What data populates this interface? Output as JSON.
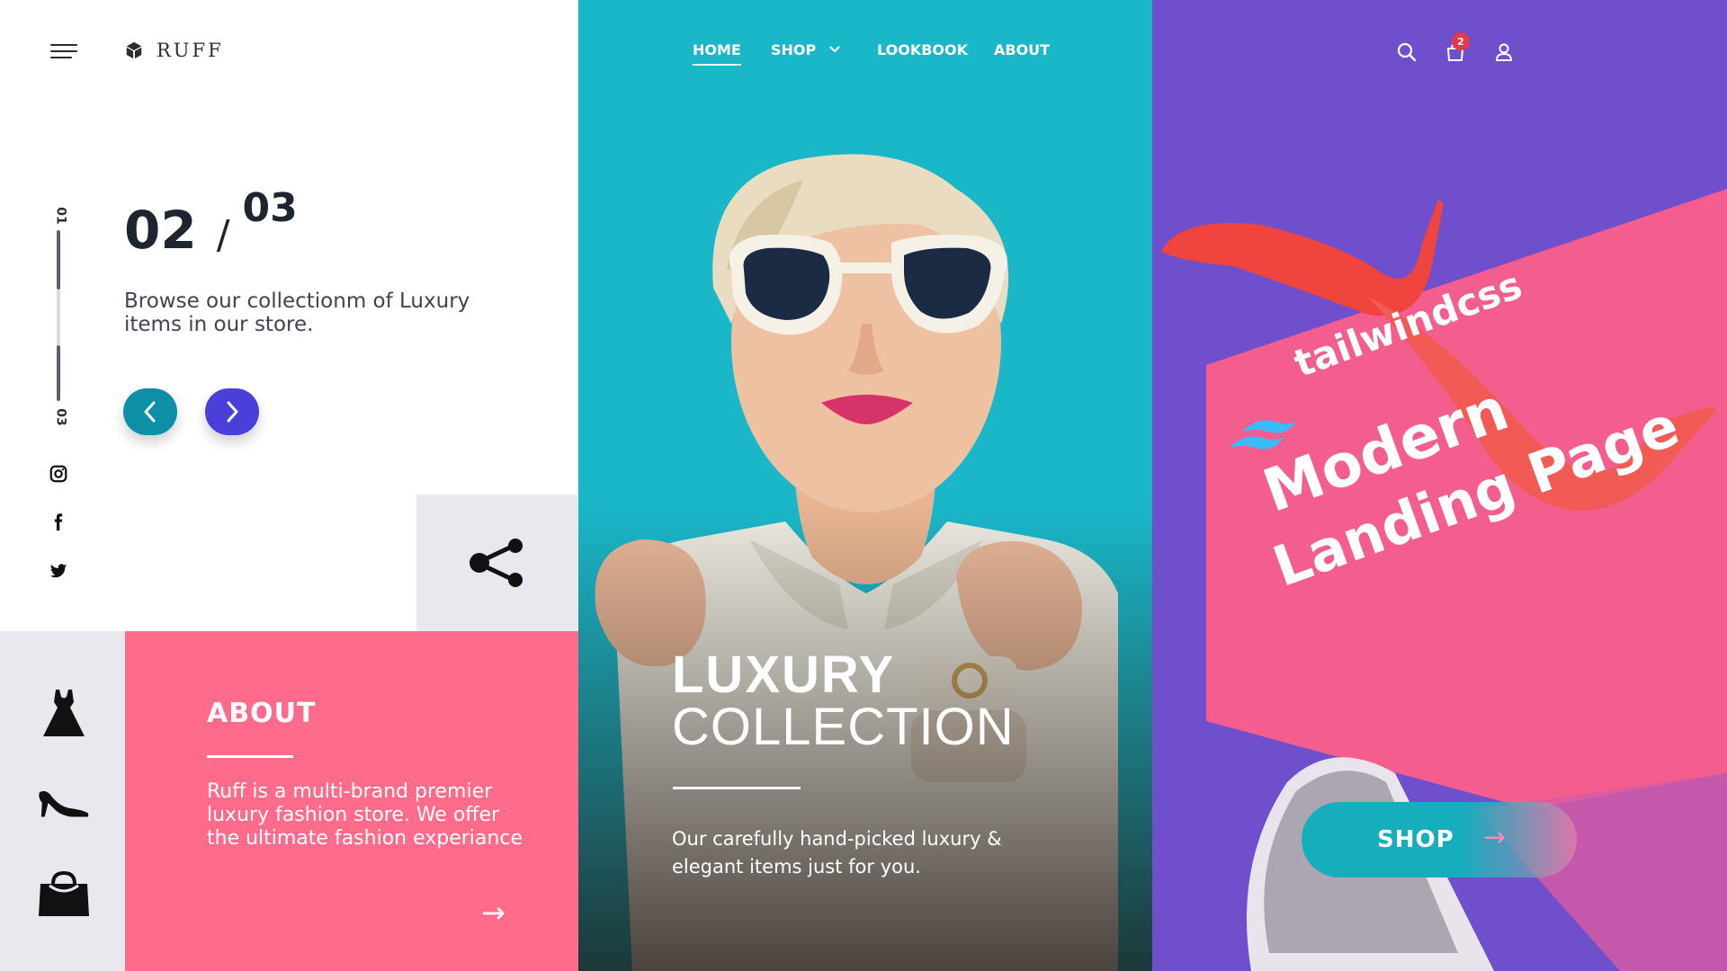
{
  "brand": {
    "name": "RUFF"
  },
  "nav": {
    "items": [
      {
        "label": "HOME",
        "active": true
      },
      {
        "label": "SHOP",
        "dropdown": true
      },
      {
        "label": "LOOKBOOK"
      },
      {
        "label": "ABOUT"
      }
    ]
  },
  "header_icons": [
    "search-icon",
    "cart-icon",
    "user-icon"
  ],
  "cart": {
    "count": "2"
  },
  "slider": {
    "current": "02",
    "separator": "/",
    "total": "03",
    "start_label": "01",
    "end_label": "03",
    "description": "Browse our collectionm of Luxury items in our store."
  },
  "social": [
    "instagram-icon",
    "facebook-icon",
    "twitter-icon"
  ],
  "categories": [
    "dress-icon",
    "heel-icon",
    "bag-icon"
  ],
  "about": {
    "title": "ABOUT",
    "body": "Ruff is a multi-brand premier luxury fashion store. We offer the ultimate fashion experiance",
    "arrow": "→"
  },
  "hero": {
    "title_line1": "LUXURY",
    "title_line2": "COLLECTION",
    "subtitle": "Our carefully hand-picked luxury & elegant items just for you."
  },
  "promo": {
    "brand": "tailwindcss",
    "line1": "Modern",
    "line2": "Landing Page"
  },
  "shop_button": {
    "label": "SHOP",
    "arrow": "→"
  },
  "colors": {
    "teal": "#1ab7c9",
    "pink": "#ff6b8b",
    "purple": "#6f4fcb",
    "indigo": "#4b3fd9",
    "dark": "#1e2530"
  }
}
